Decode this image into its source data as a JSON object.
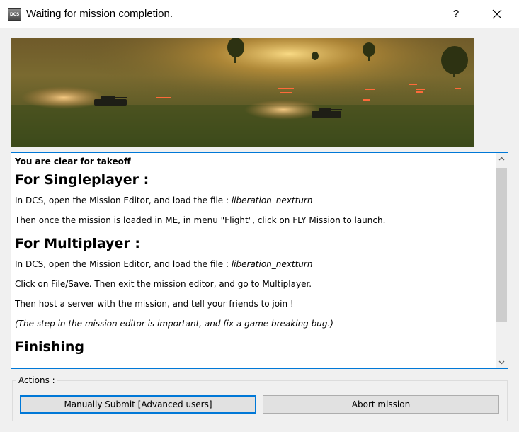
{
  "window": {
    "title": "Waiting for mission completion.",
    "icon_text": "DCS",
    "help_label": "?"
  },
  "content": {
    "clear_line": "You are clear for takeoff",
    "single": {
      "heading": "For Singleplayer :",
      "line1_prefix": "In DCS, open the Mission Editor, and load the file : ",
      "line1_file": "liberation_nextturn",
      "line2": "Then once the mission is loaded in ME, in menu \"Flight\", click on FLY Mission to launch."
    },
    "multi": {
      "heading": "For Multiplayer :",
      "line1_prefix": "In DCS, open the Mission Editor, and load the file : ",
      "line1_file": "liberation_nextturn",
      "line2": "Click on File/Save. Then exit the mission editor, and go to Multiplayer.",
      "line3": "Then host a server with the mission, and tell your friends to join !",
      "note": "(The step in the mission editor is important, and fix a game breaking bug.)"
    },
    "finishing_heading": "Finishing"
  },
  "actions": {
    "group_label": "Actions :",
    "submit_label": "Manually Submit [Advanced users]",
    "abort_label": "Abort mission"
  }
}
